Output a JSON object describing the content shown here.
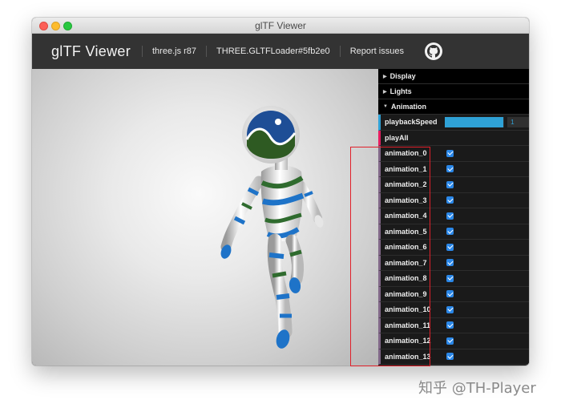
{
  "window": {
    "title": "glTF Viewer"
  },
  "header": {
    "brand": "glTF Viewer",
    "links": [
      "three.js r87",
      "THREE.GLTFLoader#5fb2e0",
      "Report issues"
    ],
    "github_icon": "github-icon"
  },
  "panel": {
    "folders": {
      "display": "Display",
      "lights": "Lights",
      "animation": "Animation"
    },
    "playback_speed": {
      "label": "playbackSpeed",
      "value": "1",
      "fill_fraction": 0.98
    },
    "play_all": "playAll",
    "animations": [
      {
        "label": "animation_0",
        "checked": true
      },
      {
        "label": "animation_1",
        "checked": true
      },
      {
        "label": "animation_2",
        "checked": true
      },
      {
        "label": "animation_3",
        "checked": true
      },
      {
        "label": "animation_4",
        "checked": true
      },
      {
        "label": "animation_5",
        "checked": true
      },
      {
        "label": "animation_6",
        "checked": true
      },
      {
        "label": "animation_7",
        "checked": true
      },
      {
        "label": "animation_8",
        "checked": true
      },
      {
        "label": "animation_9",
        "checked": true
      },
      {
        "label": "animation_10",
        "checked": true
      },
      {
        "label": "animation_11",
        "checked": true
      },
      {
        "label": "animation_12",
        "checked": true
      },
      {
        "label": "animation_13",
        "checked": true
      }
    ]
  },
  "colors": {
    "accent": "#2fa1d6",
    "highlight": "#e0202a",
    "model_blue": "#1e73c8",
    "model_green": "#2f6b2e"
  },
  "watermark": "知乎 @TH-Player"
}
